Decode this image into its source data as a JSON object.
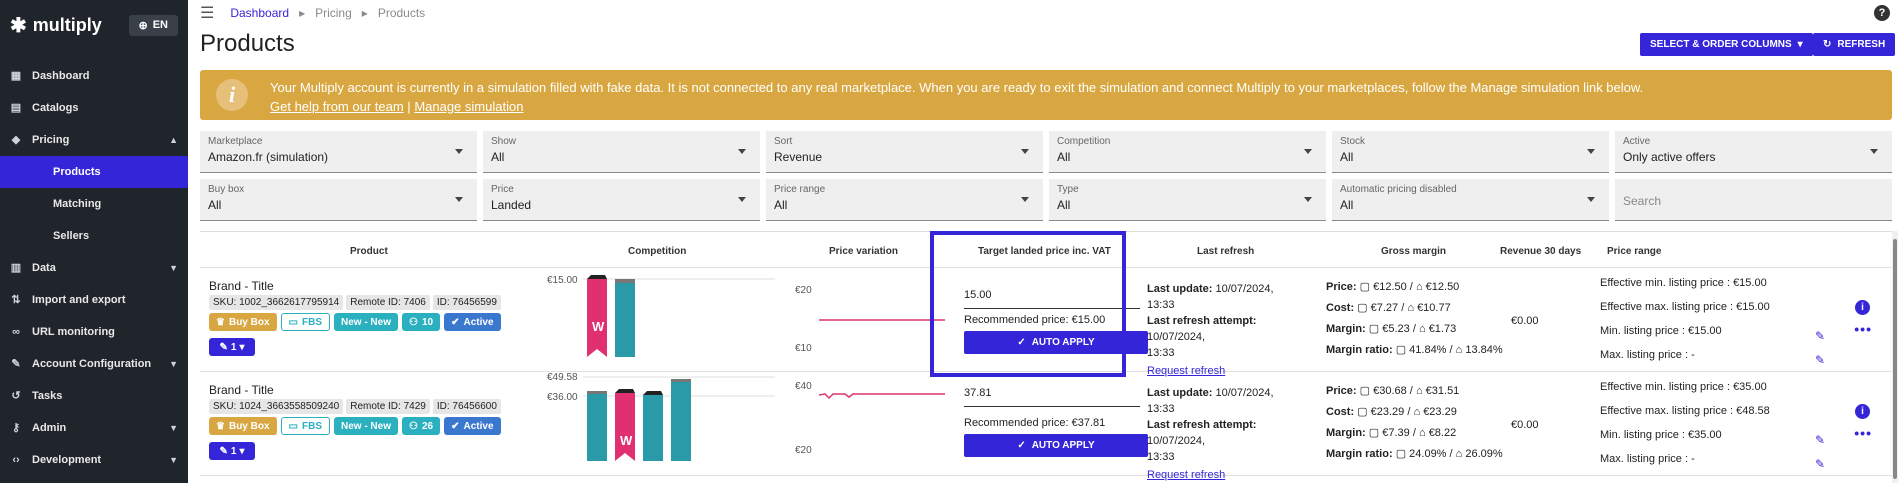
{
  "app": {
    "brand": "multiply",
    "lang": "EN"
  },
  "sidebar": {
    "items": [
      {
        "label": "Dashboard",
        "icon": "dashboard-icon"
      },
      {
        "label": "Catalogs",
        "icon": "catalog-icon"
      },
      {
        "label": "Pricing",
        "icon": "tag-icon",
        "expanded": true
      },
      {
        "label": "Products",
        "sub": true,
        "active": true
      },
      {
        "label": "Matching",
        "sub": true
      },
      {
        "label": "Sellers",
        "sub": true
      },
      {
        "label": "Data",
        "icon": "chart-icon"
      },
      {
        "label": "Import and export",
        "icon": "import-export-icon"
      },
      {
        "label": "URL monitoring",
        "icon": "link-icon"
      },
      {
        "label": "Account Configuration",
        "icon": "wrench-icon"
      },
      {
        "label": "Tasks",
        "icon": "history-icon"
      },
      {
        "label": "Admin",
        "icon": "key-icon"
      },
      {
        "label": "Development",
        "icon": "code-icon"
      }
    ]
  },
  "breadcrumb": {
    "items": [
      "Dashboard",
      "Pricing",
      "Products"
    ]
  },
  "page": {
    "title": "Products",
    "select_columns_label": "SELECT & ORDER COLUMNS",
    "refresh_label": "REFRESH"
  },
  "banner": {
    "line1": "Your Multiply account is currently in a simulation filled with fake data. It is not connected to any real marketplace. When you are ready to exit the simulation and connect Multiply to your marketplaces, follow the Manage simulation link below.",
    "help_link": "Get help from our team",
    "separator": "|",
    "manage_link": "Manage simulation",
    "color": "#d9a741"
  },
  "filters": {
    "row1": [
      {
        "label": "Marketplace",
        "value": "Amazon.fr (simulation)"
      },
      {
        "label": "Show",
        "value": "All"
      },
      {
        "label": "Sort",
        "value": "Revenue"
      },
      {
        "label": "Competition",
        "value": "All"
      },
      {
        "label": "Stock",
        "value": "All"
      },
      {
        "label": "Active",
        "value": "Only active offers"
      }
    ],
    "row2": [
      {
        "label": "Buy box",
        "value": "All"
      },
      {
        "label": "Price",
        "value": "Landed"
      },
      {
        "label": "Price range",
        "value": "All"
      },
      {
        "label": "Type",
        "value": "All"
      },
      {
        "label": "Automatic pricing disabled",
        "value": "All"
      }
    ],
    "search_placeholder": "Search"
  },
  "table": {
    "headers": {
      "product": "Product",
      "competition": "Competition",
      "price_variation": "Price variation",
      "target": "Target landed price inc. VAT",
      "last_refresh": "Last refresh",
      "gross_margin": "Gross margin",
      "revenue": "Revenue 30 days",
      "price_range": "Price range"
    },
    "rows": [
      {
        "title": "Brand - Title",
        "sku": "SKU: 1002_3662617795914",
        "remote_id": "Remote ID: 7406",
        "id": "ID: 76456599",
        "badges": {
          "buybox": "Buy Box",
          "fbs": "FBS",
          "new": "New - New",
          "count": "10",
          "active": "Active"
        },
        "link_count": "1",
        "competition": {
          "top_label": "€15.00"
        },
        "variation": {
          "ticks": [
            "€20",
            "€10"
          ]
        },
        "target_value": "15.00",
        "recommended": "Recommended price: €15.00",
        "auto_apply": "AUTO APPLY",
        "last_update_label": "Last update:",
        "last_update": "10/07/2024, 13:33",
        "last_attempt_label": "Last refresh attempt:",
        "last_attempt_1": "10/07/2024,",
        "last_attempt_2": "13:33",
        "request_refresh": "Request refresh",
        "price_label": "Price:",
        "price": "€12.50 / ",
        "price2": "€12.50",
        "cost_label": "Cost:",
        "cost": "€7.27 / ",
        "cost2": "€10.77",
        "margin_label": "Margin:",
        "margin": "€5.23 / ",
        "margin2": "€1.73",
        "ratio_label": "Margin ratio:",
        "ratio": "41.84% / ",
        "ratio2": "13.84%",
        "revenue": "€0.00",
        "eff_min": "Effective min. listing price :  €15.00",
        "eff_max": "Effective max. listing price :  €15.00",
        "min": "Min. listing price :  €15.00",
        "max": "Max. listing price :  -"
      },
      {
        "title": "Brand - Title",
        "sku": "SKU: 1024_3663558509240",
        "remote_id": "Remote ID: 7429",
        "id": "ID: 76456600",
        "badges": {
          "buybox": "Buy Box",
          "fbs": "FBS",
          "new": "New - New",
          "count": "26",
          "active": "Active"
        },
        "link_count": "1",
        "competition": {
          "top_label": "€49.58",
          "mid_label": "€36.00"
        },
        "variation": {
          "ticks": [
            "€40",
            "€20"
          ]
        },
        "target_value": "37.81",
        "recommended": "Recommended price: €37.81",
        "auto_apply": "AUTO APPLY",
        "last_update_label": "Last update:",
        "last_update": "10/07/2024, 13:33",
        "last_attempt_label": "Last refresh attempt:",
        "last_attempt_1": "10/07/2024,",
        "last_attempt_2": "13:33",
        "request_refresh": "Request refresh",
        "price_label": "Price:",
        "price": "€30.68 / ",
        "price2": "€31.51",
        "cost_label": "Cost:",
        "cost": "€23.29 / ",
        "cost2": "€23.29",
        "margin_label": "Margin:",
        "margin": "€7.39 / ",
        "margin2": "€8.22",
        "ratio_label": "Margin ratio:",
        "ratio": "24.09% / ",
        "ratio2": "26.09%",
        "revenue": "€0.00",
        "eff_min": "Effective min. listing price :  €35.00",
        "eff_max": "Effective max. listing price :  €48.58",
        "min": "Min. listing price :  €35.00",
        "max": "Max. listing price :  -"
      }
    ]
  },
  "colors": {
    "accent": "#3525d8",
    "banner": "#d9a741",
    "teal": "#2b9aa8",
    "pink": "#e0306f",
    "sidebar": "#1f252b"
  }
}
